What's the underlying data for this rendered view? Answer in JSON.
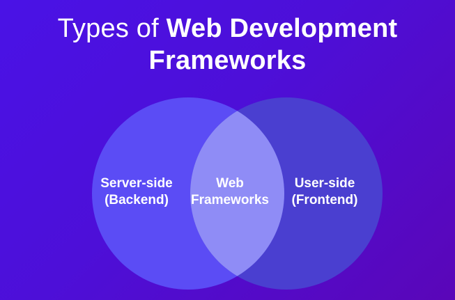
{
  "title": {
    "prefix": "Types of",
    "bold_line1": "Web Development",
    "bold_line2": "Frameworks"
  },
  "diagram": {
    "type": "venn",
    "left_circle": {
      "line1": "Server-side",
      "line2": "(Backend)",
      "color": "#5b4cf5"
    },
    "intersection": {
      "line1": "Web",
      "line2": "Frameworks",
      "color": "#8f8cf6"
    },
    "right_circle": {
      "line1": "User-side",
      "line2": "(Frontend)",
      "color": "#4a3fd0"
    }
  },
  "colors": {
    "background_start": "#4a12e6",
    "background_end": "#5a06b8",
    "text": "#ffffff"
  }
}
